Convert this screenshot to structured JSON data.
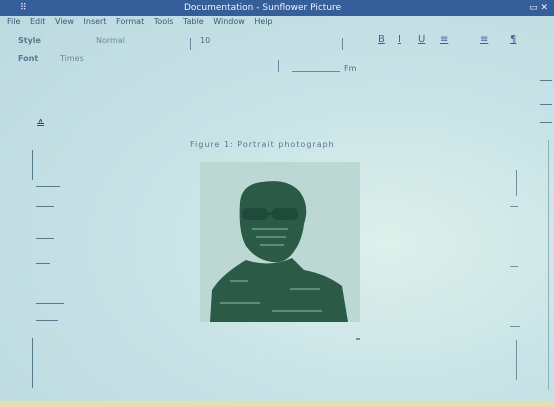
{
  "window": {
    "title": "Documentation - Sunflower Picture",
    "system_menu": "⠿",
    "controls": "▭ ✕"
  },
  "menu": [
    "File",
    "Edit",
    "View",
    "Insert",
    "Format",
    "Tools",
    "Table",
    "Window",
    "Help"
  ],
  "toolbar": {
    "style_label": "Style",
    "style_value": "Normal",
    "font_label": "Font",
    "font_value": "Times",
    "size_value": "10",
    "ruler_label": "Fm",
    "formatting_buttons": [
      "B",
      "I",
      "U",
      "≡",
      "≡",
      "¶"
    ]
  },
  "document": {
    "caption_line": "Figure 1: Portrait photograph",
    "left_marker": "≙"
  }
}
